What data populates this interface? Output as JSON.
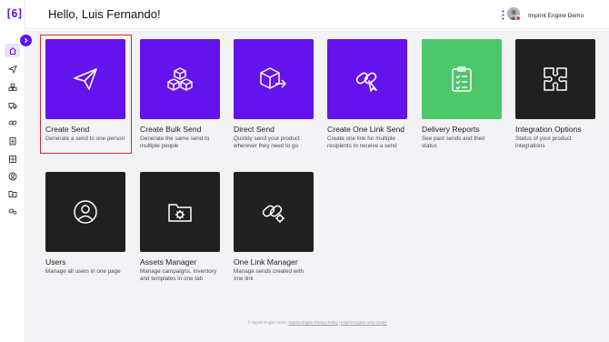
{
  "app": {
    "logo_text": "[6]",
    "brand_color": "#5d16e9"
  },
  "header": {
    "greeting": "Hello, Luis Fernando!",
    "user_name": "Imprint Engine Demo"
  },
  "sidebar": {
    "items": [
      {
        "icon": "home-icon",
        "active": true
      },
      {
        "icon": "send-icon"
      },
      {
        "icon": "bulk-send-icon"
      },
      {
        "icon": "delivery-truck-icon"
      },
      {
        "icon": "one-link-icon"
      },
      {
        "icon": "clipboard-icon"
      },
      {
        "icon": "puzzle-icon"
      },
      {
        "icon": "users-icon"
      },
      {
        "icon": "assets-icon"
      },
      {
        "icon": "link-manager-icon"
      }
    ]
  },
  "cards": [
    {
      "title": "Create Send",
      "desc": "Generate a send to one person",
      "tile_color": "#6413ec",
      "icon": "paper-plane-icon"
    },
    {
      "title": "Create Bulk Send",
      "desc": "Generate the same send to multiple people",
      "tile_color": "#6413ec",
      "icon": "boxes-icon"
    },
    {
      "title": "Direct Send",
      "desc": "Quickly send your product wherever they need to go",
      "tile_color": "#6413ec",
      "icon": "box-arrow-icon"
    },
    {
      "title": "Create One Link Send",
      "desc": "Create one link for multiple recipients to receive a send",
      "tile_color": "#6413ec",
      "icon": "link-cursor-icon"
    },
    {
      "title": "Delivery Reports",
      "desc": "See past sends and their status",
      "tile_color": "#4cc76a",
      "icon": "clipboard-check-icon"
    },
    {
      "title": "Integration Options",
      "desc": "Status of your product integrations",
      "tile_color": "#202020",
      "icon": "puzzle-icon"
    },
    {
      "title": "Users",
      "desc": "Manage all users in one page",
      "tile_color": "#202020",
      "icon": "user-circle-icon"
    },
    {
      "title": "Assets Manager",
      "desc": "Manage campaigns, inventory and templates in one tab",
      "tile_color": "#202020",
      "icon": "folder-gear-icon"
    },
    {
      "title": "One Link Manager",
      "desc": "Manage sends created with one link",
      "tile_color": "#202020",
      "icon": "link-gear-icon"
    }
  ],
  "footer": {
    "copyright": "© Imprint Engine 2020",
    "privacy": "Imprint Engine Privacy Policy",
    "separator": "|",
    "help": "Imprint Engine Help Center"
  }
}
